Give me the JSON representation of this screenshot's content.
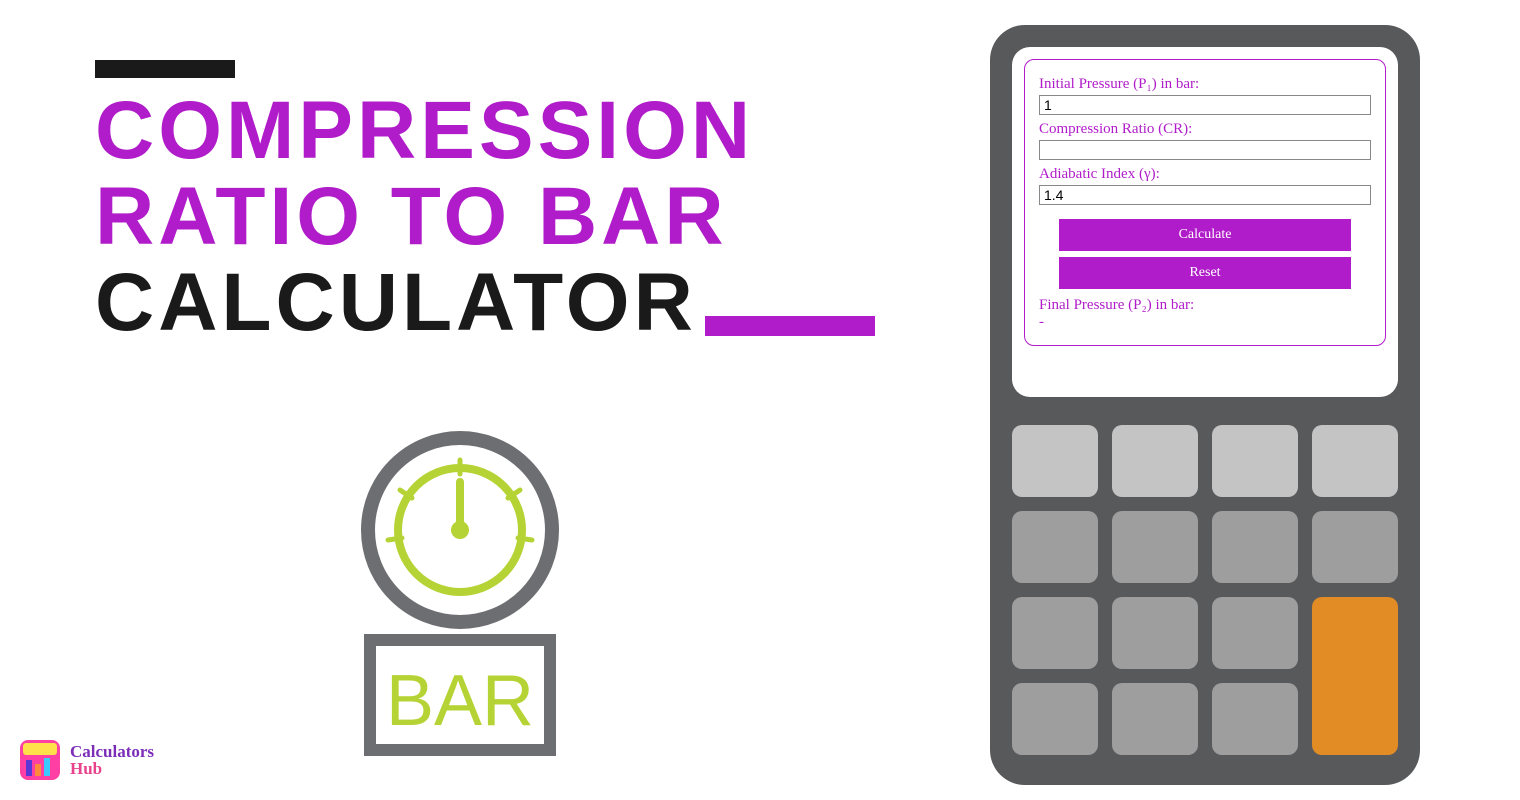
{
  "title": {
    "line1": "COMPRESSION",
    "line2": "RATIO TO BAR",
    "line3": "CALCULATOR"
  },
  "gauge": {
    "label": "BAR"
  },
  "form": {
    "p1_label": "Initial Pressure (P₁) in bar:",
    "p1_value": "1",
    "cr_label": "Compression Ratio (CR):",
    "cr_value": "",
    "gamma_label": "Adiabatic Index (γ):",
    "gamma_value": "1.4",
    "calculate_label": "Calculate",
    "reset_label": "Reset",
    "result_label": "Final Pressure (P₂) in bar:",
    "result_value": "-"
  },
  "logo": {
    "word1": "Calculators",
    "word2": "Hub"
  },
  "colors": {
    "purple": "#b01cc9",
    "black": "#1a1a1a",
    "gray": "#58595b",
    "orange": "#e28c26",
    "lime": "#b5d334"
  }
}
